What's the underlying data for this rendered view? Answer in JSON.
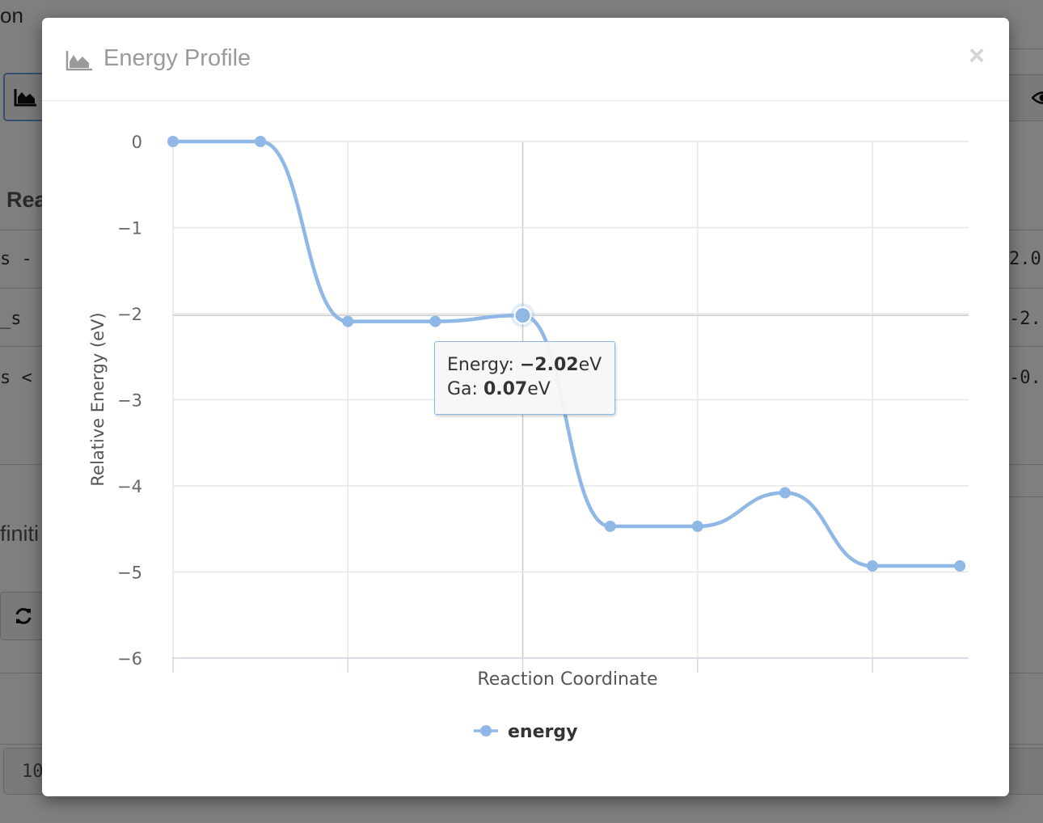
{
  "background": {
    "partial_texts": [
      "on",
      "Rea",
      "finiti"
    ],
    "row_fragments_left": [
      "s -",
      "_s",
      "s <"
    ],
    "row_fragments_right": [
      "2.0",
      "-2.",
      "-0."
    ],
    "bottom_field_value": "10",
    "button_icons": [
      "area-chart-icon",
      "refresh-icon",
      "eye-icon"
    ]
  },
  "modal": {
    "title": "Energy Profile",
    "title_icon": "area-chart-icon",
    "close_label": "×"
  },
  "tooltip": {
    "energy_label": "Energy:",
    "energy_value": "−2.02",
    "energy_unit": "eV",
    "ga_label": "Ga:",
    "ga_value": "0.07",
    "ga_unit": "eV"
  },
  "colors": {
    "series": "#90b8e6",
    "backdrop": "rgba(0,0,0,0.5)"
  },
  "chart_data": {
    "type": "line",
    "title": "",
    "xlabel": "Reaction Coordinate",
    "ylabel": "Relative Energy (eV)",
    "ylim": [
      -6,
      0
    ],
    "yticks": [
      "0",
      "−1",
      "−2",
      "−3",
      "−4",
      "−5",
      "−6"
    ],
    "ytick_values": [
      0,
      -1,
      -2,
      -3,
      -4,
      -5,
      -6
    ],
    "x": [
      0,
      1,
      2,
      3,
      4,
      5,
      6,
      7,
      8,
      9
    ],
    "xlim": [
      0,
      9.1
    ],
    "series": [
      {
        "name": "energy",
        "values": [
          0,
          0,
          -2.09,
          -2.09,
          -2.02,
          -4.47,
          -4.47,
          -4.08,
          -4.93,
          -4.93
        ]
      }
    ],
    "highlighted_index": 4,
    "grid": true,
    "legend": "bottom-center"
  }
}
